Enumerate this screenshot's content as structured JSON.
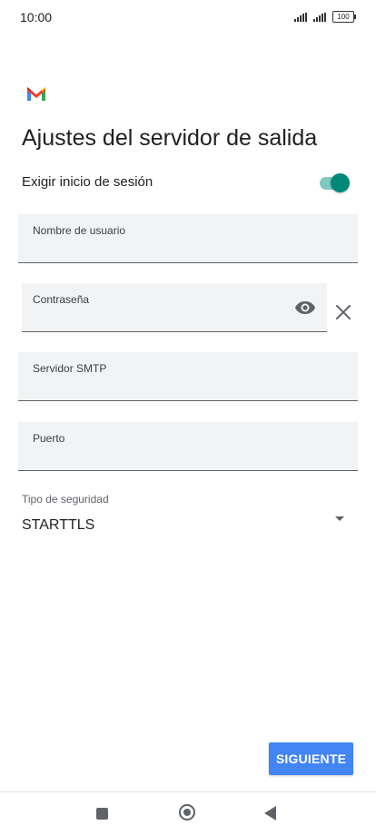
{
  "status_bar": {
    "time": "10:00",
    "battery": "100"
  },
  "header": {
    "logo_icon": "gmail-logo-icon",
    "title": "Ajustes del servidor de salida"
  },
  "login_toggle": {
    "label": "Exigir inicio de sesión",
    "enabled": true,
    "accent_color": "#00897b"
  },
  "fields": {
    "username": {
      "label": "Nombre de usuario",
      "value": ""
    },
    "password": {
      "label": "Contraseña",
      "value": "",
      "visibility_icon": "eye-icon",
      "clear_icon": "close-icon"
    },
    "smtp_server": {
      "label": "Servidor SMTP",
      "value": ""
    },
    "port": {
      "label": "Puerto",
      "value": ""
    }
  },
  "security": {
    "label": "Tipo de seguridad",
    "value": "STARTTLS"
  },
  "actions": {
    "next_label": "SIGUIENTE",
    "next_color": "#4285f4"
  }
}
